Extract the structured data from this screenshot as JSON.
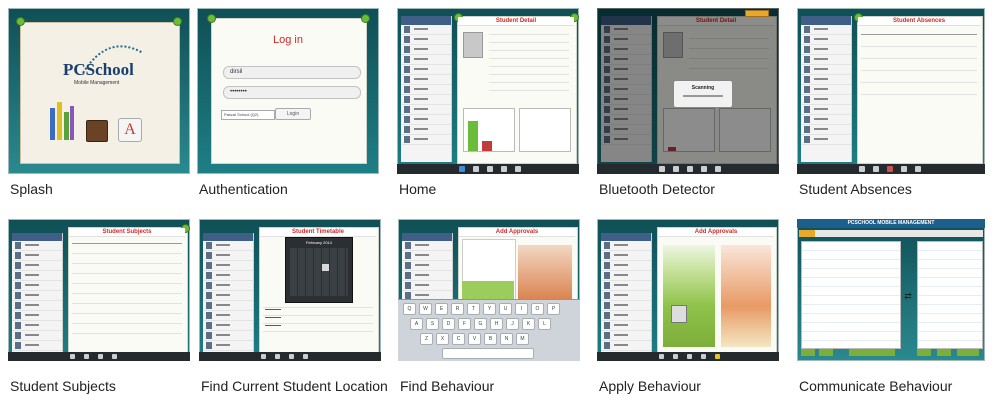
{
  "screens": [
    {
      "caption": "Splash",
      "logo_text": "PCSchool",
      "logo_sub": "Mobile Management"
    },
    {
      "caption": "Authentication",
      "login_title": "Log in",
      "user_value": "dirsil",
      "password_mask": "••••••••",
      "login_button": "Login",
      "dropdown_value": "Pascal School (Q2)"
    },
    {
      "caption": "Home",
      "header": "Student Detail"
    },
    {
      "caption": "Bluetooth Detector",
      "header": "Student Detail",
      "dialog_title": "Scanning"
    },
    {
      "caption": "Student Absences",
      "header": "Student Absences"
    },
    {
      "caption": "Student Subjects",
      "header": "Student Subjects"
    },
    {
      "caption": "Find Current Student Location",
      "header": "Student Timetable",
      "calendar_month": "February 2014"
    },
    {
      "caption": "Find Behaviour",
      "header": "Add Approvals"
    },
    {
      "caption": "Apply Behaviour",
      "header": "Add Approvals"
    },
    {
      "caption": "Communicate Behaviour",
      "header": "PCSCHOOL MOBILE MANAGEMENT"
    }
  ],
  "keyboard": {
    "row1": [
      "Q",
      "W",
      "E",
      "R",
      "T",
      "Y",
      "U",
      "I",
      "O",
      "P"
    ],
    "row2": [
      "A",
      "S",
      "D",
      "F",
      "G",
      "H",
      "J",
      "K",
      "L"
    ],
    "row3": [
      "Z",
      "X",
      "C",
      "V",
      "B",
      "N",
      "M"
    ]
  },
  "colors": {
    "teal": "#1e7f86",
    "pin": "#6cbc3c",
    "header_red": "#d12a2a"
  }
}
